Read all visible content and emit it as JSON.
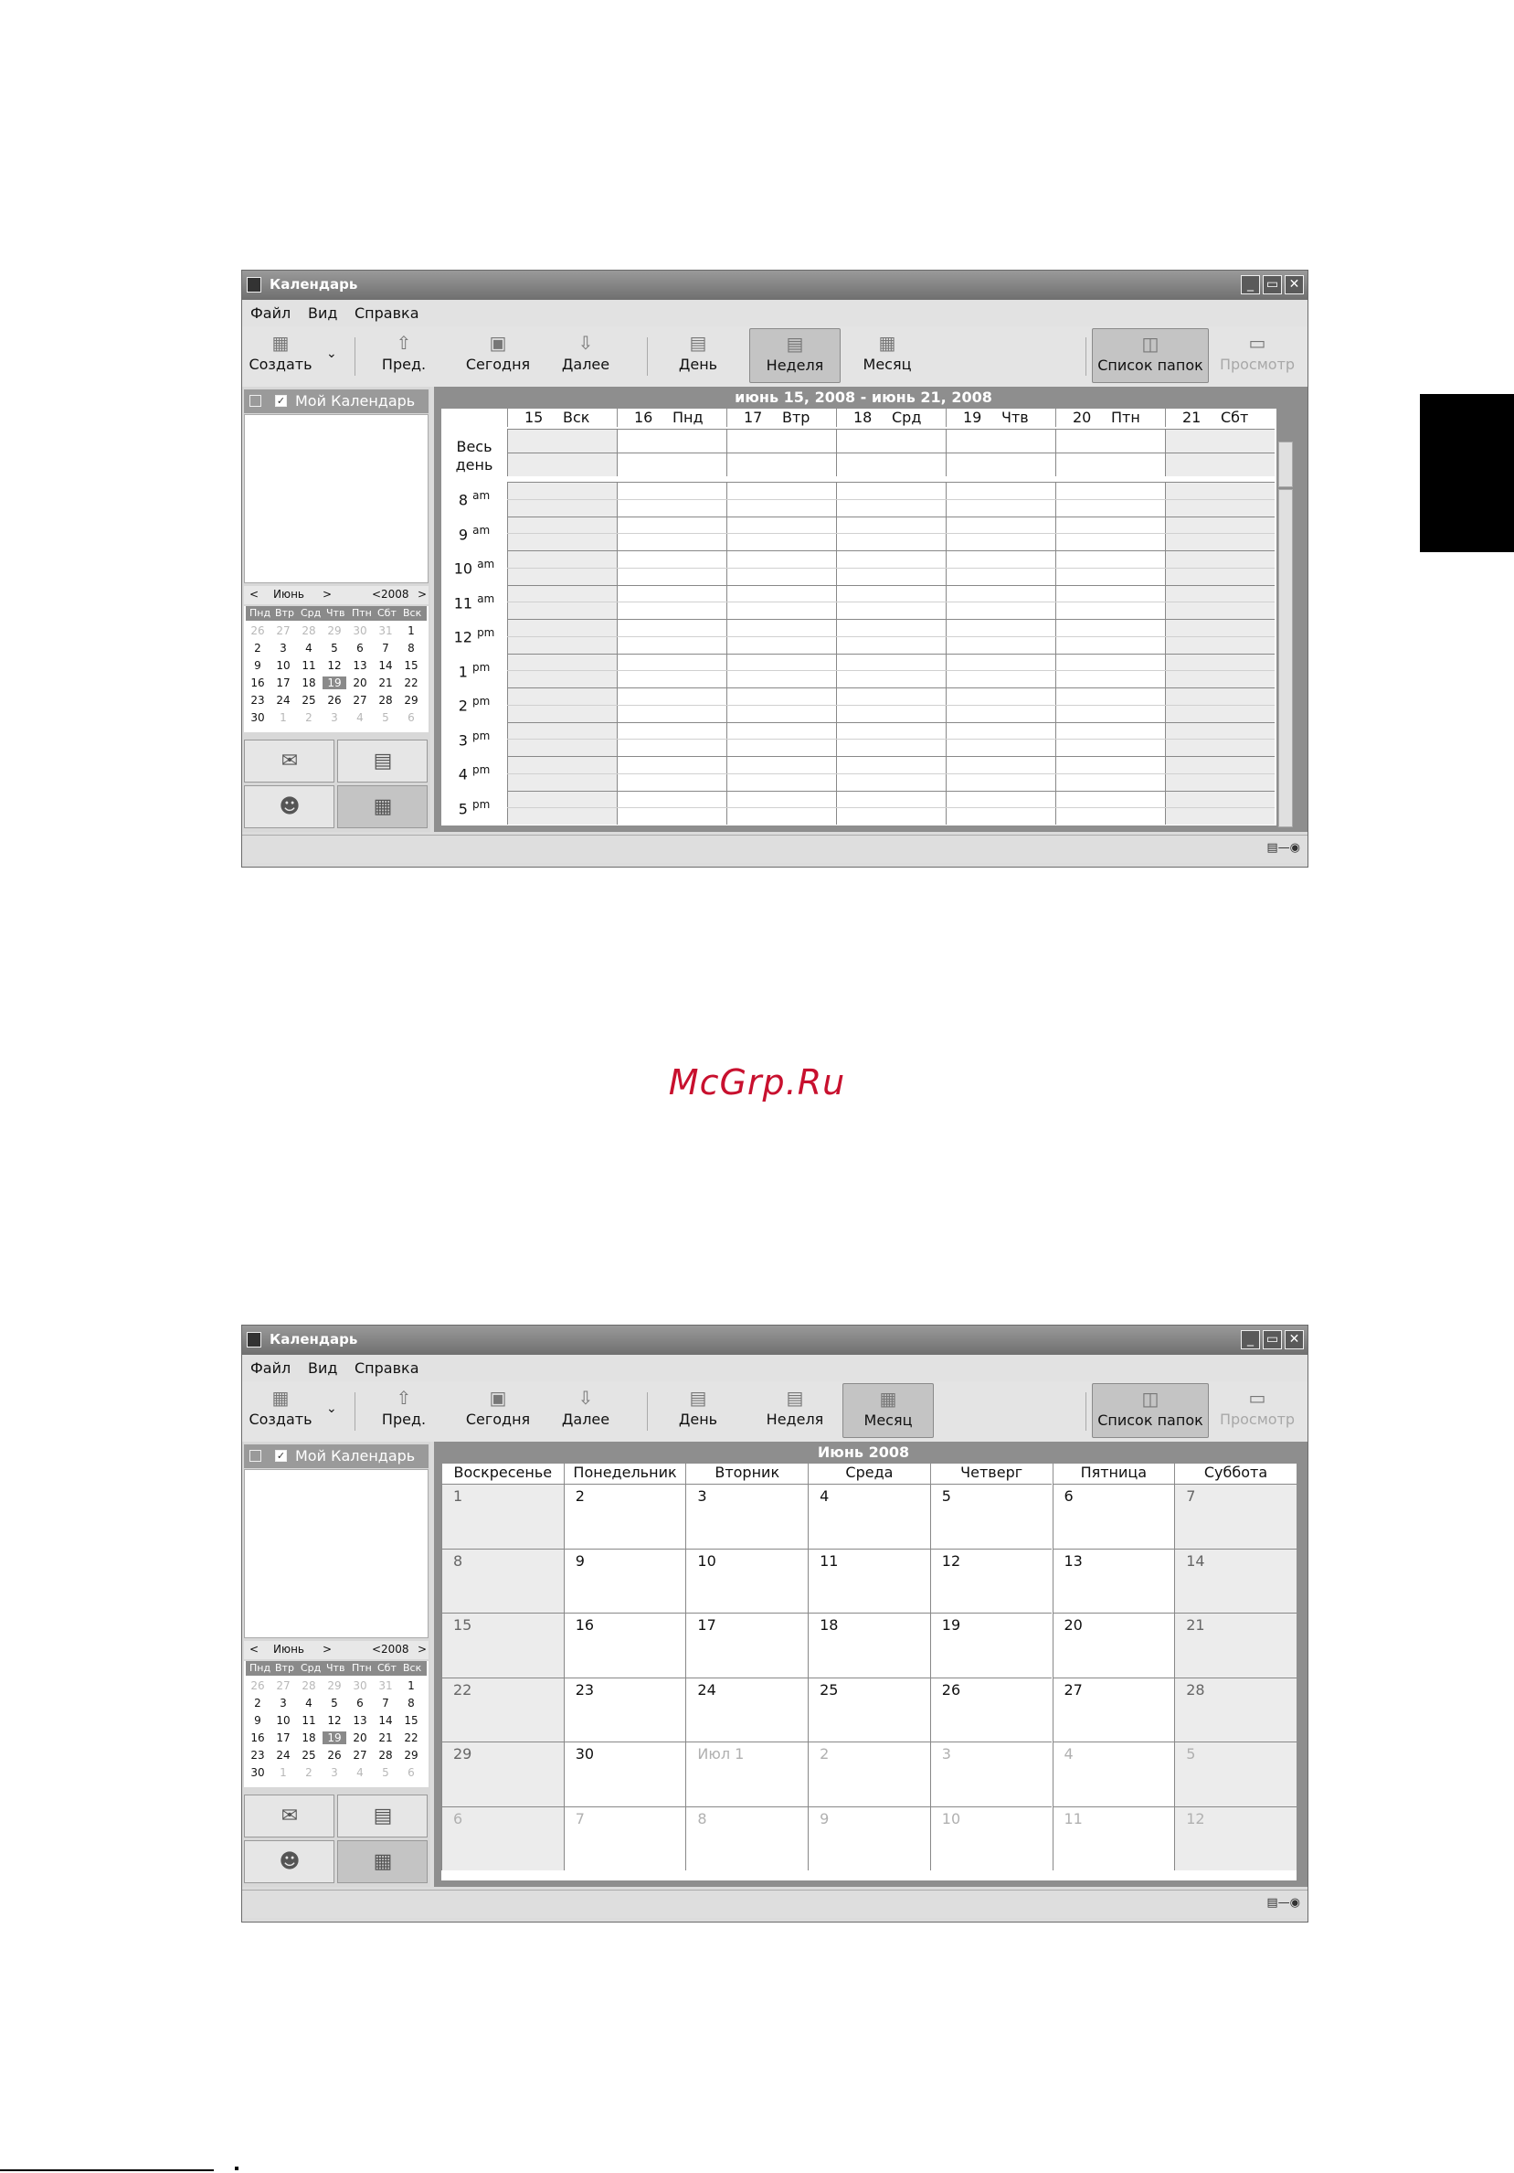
{
  "watermark": "McGrp.Ru",
  "window": {
    "title": "Календарь",
    "buttons": {
      "minimize": "_",
      "maximize": "▭",
      "close": "✕"
    }
  },
  "menu": [
    "Файл",
    "Вид",
    "Справка"
  ],
  "toolbar": {
    "create": "Создать",
    "prev": "Пред.",
    "today": "Сегодня",
    "next": "Далее",
    "day": "День",
    "week": "Неделя",
    "month": "Месяц",
    "folders": "Список папок",
    "preview": "Просмотр"
  },
  "sidebar": {
    "calendar_name": "Мой Календарь",
    "mini_month": "Июнь",
    "mini_year": "2008",
    "weekdays": [
      "Пнд",
      "Втр",
      "Срд",
      "Чтв",
      "Птн",
      "Сбт",
      "Вск"
    ],
    "rows": [
      [
        "26",
        "27",
        "28",
        "29",
        "30",
        "31",
        "1"
      ],
      [
        "2",
        "3",
        "4",
        "5",
        "6",
        "7",
        "8"
      ],
      [
        "9",
        "10",
        "11",
        "12",
        "13",
        "14",
        "15"
      ],
      [
        "16",
        "17",
        "18",
        "19",
        "20",
        "21",
        "22"
      ],
      [
        "23",
        "24",
        "25",
        "26",
        "27",
        "28",
        "29"
      ],
      [
        "30",
        "1",
        "2",
        "3",
        "4",
        "5",
        "6"
      ]
    ],
    "selected": "19"
  },
  "week_view": {
    "range_title": "июнь  15,  2008  -  июнь  21,  2008",
    "days": [
      {
        "num": "15",
        "name": "Вск"
      },
      {
        "num": "16",
        "name": "Пнд"
      },
      {
        "num": "17",
        "name": "Втр"
      },
      {
        "num": "18",
        "name": "Срд"
      },
      {
        "num": "19",
        "name": "Чтв"
      },
      {
        "num": "20",
        "name": "Птн"
      },
      {
        "num": "21",
        "name": "Сбт"
      }
    ],
    "all_day_1": "Весь",
    "all_day_2": "день",
    "hours": [
      {
        "h": "8",
        "s": "am"
      },
      {
        "h": "9",
        "s": "am"
      },
      {
        "h": "10",
        "s": "am"
      },
      {
        "h": "11",
        "s": "am"
      },
      {
        "h": "12",
        "s": "pm"
      },
      {
        "h": "1",
        "s": "pm"
      },
      {
        "h": "2",
        "s": "pm"
      },
      {
        "h": "3",
        "s": "pm"
      },
      {
        "h": "4",
        "s": "pm"
      },
      {
        "h": "5",
        "s": "pm"
      }
    ]
  },
  "month_view": {
    "title": "Июнь   2008",
    "weekdays": [
      "Воскресенье",
      "Понедельник",
      "Вторник",
      "Среда",
      "Четверг",
      "Пятница",
      "Суббота"
    ],
    "rows": [
      [
        "1",
        "2",
        "3",
        "4",
        "5",
        "6",
        "7"
      ],
      [
        "8",
        "9",
        "10",
        "11",
        "12",
        "13",
        "14"
      ],
      [
        "15",
        "16",
        "17",
        "18",
        "19",
        "20",
        "21"
      ],
      [
        "22",
        "23",
        "24",
        "25",
        "26",
        "27",
        "28"
      ],
      [
        "29",
        "30",
        "Июл  1",
        "2",
        "3",
        "4",
        "5"
      ],
      [
        "6",
        "7",
        "8",
        "9",
        "10",
        "11",
        "12"
      ]
    ]
  }
}
